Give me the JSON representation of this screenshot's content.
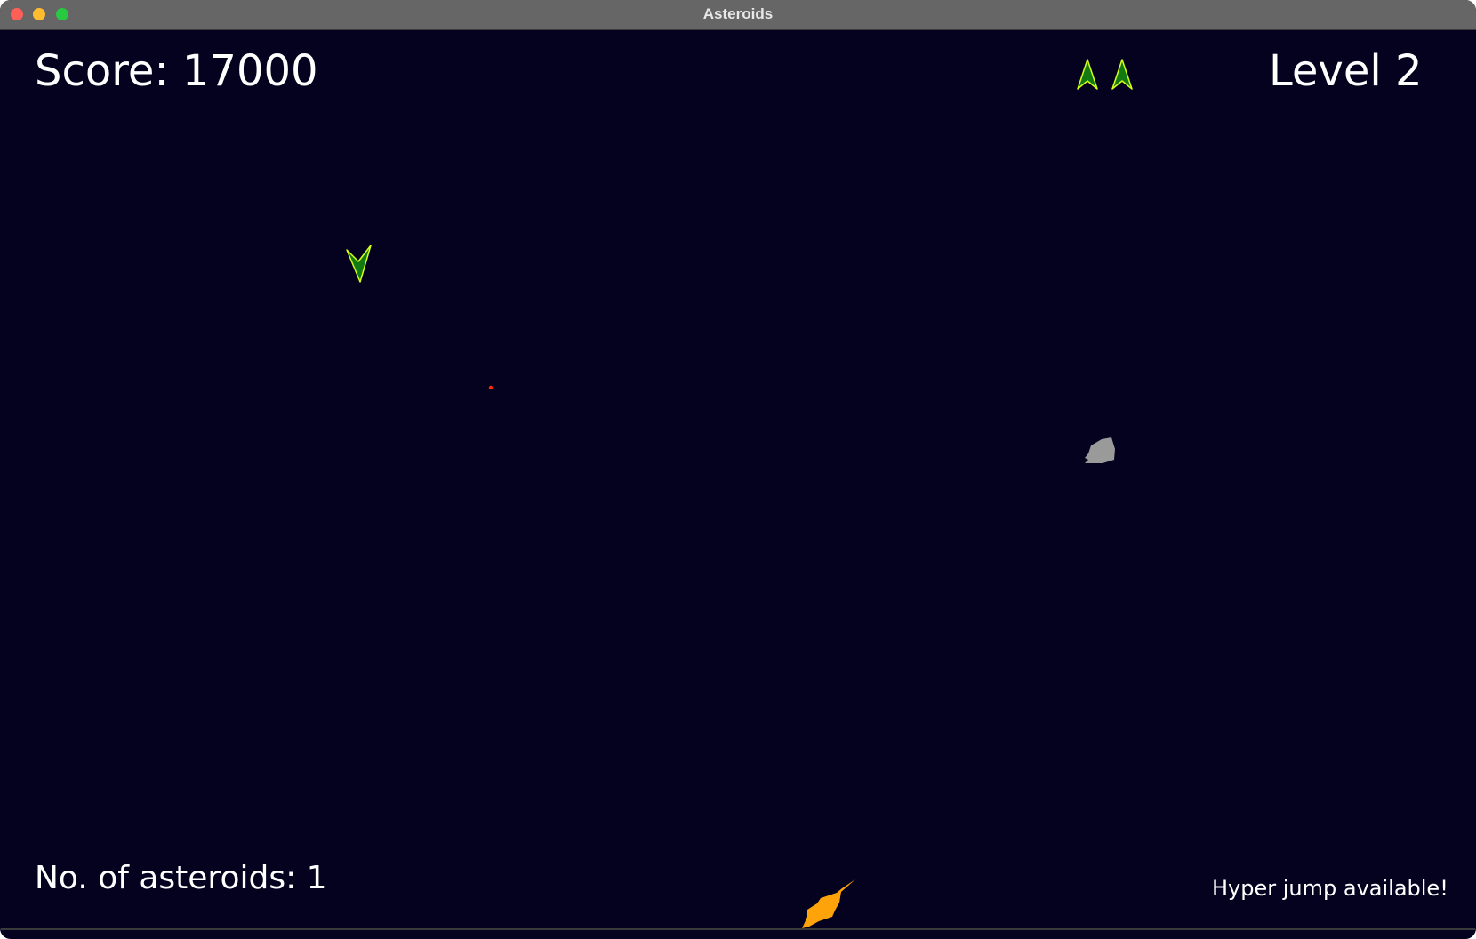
{
  "window": {
    "title": "Asteroids",
    "controls": {
      "close_color": "#ff5f57",
      "minimize_color": "#febc2e",
      "zoom_color": "#28c840"
    }
  },
  "hud": {
    "score_text": "Score: 17000",
    "level_text": "Level 2",
    "asteroid_count_text": "No. of asteroids: 1",
    "hyper_jump_text": "Hyper jump available!",
    "lives_remaining": 2
  },
  "colors": {
    "background": "#050220",
    "text": "#ffffff",
    "ship_fill": "#137a12",
    "ship_outline": "#d4ff1a",
    "asteroid": "#9a9a9a",
    "enemy_ship": "#ffa30a",
    "bullet": "#ff2a00"
  },
  "sprites": {
    "player_ship_icon": "player-ship-icon",
    "life_icon": "life-ship-icon",
    "asteroid_icon": "asteroid-icon",
    "enemy_icon": "enemy-ship-icon",
    "bullet_icon": "bullet-icon"
  }
}
